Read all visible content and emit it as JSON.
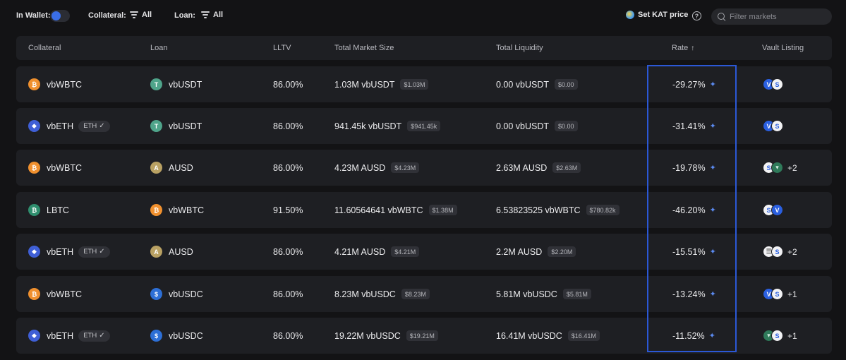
{
  "toolbar": {
    "in_wallet_label": "In Wallet:",
    "collateral_label": "Collateral:",
    "collateral_value": "All",
    "loan_label": "Loan:",
    "loan_value": "All",
    "set_price_label": "Set KAT price",
    "help_icon": "?",
    "search_placeholder": "Filter markets"
  },
  "columns": {
    "collateral": "Collateral",
    "loan": "Loan",
    "lltv": "LLTV",
    "total_market_size": "Total Market Size",
    "total_liquidity": "Total Liquidity",
    "rate": "Rate",
    "rate_sort_icon": "↑",
    "vault_listing": "Vault Listing"
  },
  "colors": {
    "accent": "#3a6ee8",
    "highlight_border": "#2b58d6",
    "row_bg": "#1e1f23",
    "page_bg": "#131315"
  },
  "rows": [
    {
      "collateral": "vbWBTC",
      "collateral_icon": "btc",
      "collateral_glyph": "₿",
      "collateral_chip": "",
      "loan": "vbUSDT",
      "loan_icon": "usdt",
      "loan_glyph": "T",
      "lltv": "86.00%",
      "market_size": "1.03M vbUSDT",
      "market_size_usd": "$1.03M",
      "liquidity": "0.00 vbUSDT",
      "liquidity_usd": "$0.00",
      "rate": "-29.27%",
      "vaults": [
        {
          "glyph": "V",
          "cls": "v-blue"
        },
        {
          "glyph": "S",
          "cls": "v-white"
        }
      ],
      "vault_more": ""
    },
    {
      "collateral": "vbETH",
      "collateral_icon": "eth",
      "collateral_glyph": "◆",
      "collateral_chip": "ETH",
      "loan": "vbUSDT",
      "loan_icon": "usdt",
      "loan_glyph": "T",
      "lltv": "86.00%",
      "market_size": "941.45k vbUSDT",
      "market_size_usd": "$941.45k",
      "liquidity": "0.00 vbUSDT",
      "liquidity_usd": "$0.00",
      "rate": "-31.41%",
      "vaults": [
        {
          "glyph": "V",
          "cls": "v-blue"
        },
        {
          "glyph": "S",
          "cls": "v-white"
        }
      ],
      "vault_more": ""
    },
    {
      "collateral": "vbWBTC",
      "collateral_icon": "btc",
      "collateral_glyph": "₿",
      "collateral_chip": "",
      "loan": "AUSD",
      "loan_icon": "ausd",
      "loan_glyph": "A",
      "lltv": "86.00%",
      "market_size": "4.23M AUSD",
      "market_size_usd": "$4.23M",
      "liquidity": "2.63M AUSD",
      "liquidity_usd": "$2.63M",
      "rate": "-19.78%",
      "vaults": [
        {
          "glyph": "S",
          "cls": "v-white"
        },
        {
          "glyph": "▾",
          "cls": "v-green"
        }
      ],
      "vault_more": "+2"
    },
    {
      "collateral": "LBTC",
      "collateral_icon": "lbtc",
      "collateral_glyph": "₿",
      "collateral_chip": "",
      "loan": "vbWBTC",
      "loan_icon": "btc",
      "loan_glyph": "₿",
      "lltv": "91.50%",
      "market_size": "11.60564641 vbWBTC",
      "market_size_usd": "$1.38M",
      "liquidity": "6.53823525 vbWBTC",
      "liquidity_usd": "$780.82k",
      "rate": "-46.20%",
      "vaults": [
        {
          "glyph": "S",
          "cls": "v-white"
        },
        {
          "glyph": "V",
          "cls": "v-blue"
        }
      ],
      "vault_more": ""
    },
    {
      "collateral": "vbETH",
      "collateral_icon": "eth",
      "collateral_glyph": "◆",
      "collateral_chip": "ETH",
      "loan": "AUSD",
      "loan_icon": "ausd",
      "loan_glyph": "A",
      "lltv": "86.00%",
      "market_size": "4.21M AUSD",
      "market_size_usd": "$4.21M",
      "liquidity": "2.2M AUSD",
      "liquidity_usd": "$2.20M",
      "rate": "-15.51%",
      "vaults": [
        {
          "glyph": "☰",
          "cls": "v-dark"
        },
        {
          "glyph": "S",
          "cls": "v-white"
        }
      ],
      "vault_more": "+2"
    },
    {
      "collateral": "vbWBTC",
      "collateral_icon": "btc",
      "collateral_glyph": "₿",
      "collateral_chip": "",
      "loan": "vbUSDC",
      "loan_icon": "usdc",
      "loan_glyph": "$",
      "lltv": "86.00%",
      "market_size": "8.23M vbUSDC",
      "market_size_usd": "$8.23M",
      "liquidity": "5.81M vbUSDC",
      "liquidity_usd": "$5.81M",
      "rate": "-13.24%",
      "vaults": [
        {
          "glyph": "V",
          "cls": "v-blue"
        },
        {
          "glyph": "S",
          "cls": "v-white"
        }
      ],
      "vault_more": "+1"
    },
    {
      "collateral": "vbETH",
      "collateral_icon": "eth",
      "collateral_glyph": "◆",
      "collateral_chip": "ETH",
      "loan": "vbUSDC",
      "loan_icon": "usdc",
      "loan_glyph": "$",
      "lltv": "86.00%",
      "market_size": "19.22M vbUSDC",
      "market_size_usd": "$19.21M",
      "liquidity": "16.41M vbUSDC",
      "liquidity_usd": "$16.41M",
      "rate": "-11.52%",
      "vaults": [
        {
          "glyph": "▾",
          "cls": "v-green"
        },
        {
          "glyph": "S",
          "cls": "v-white"
        }
      ],
      "vault_more": "+1"
    }
  ]
}
